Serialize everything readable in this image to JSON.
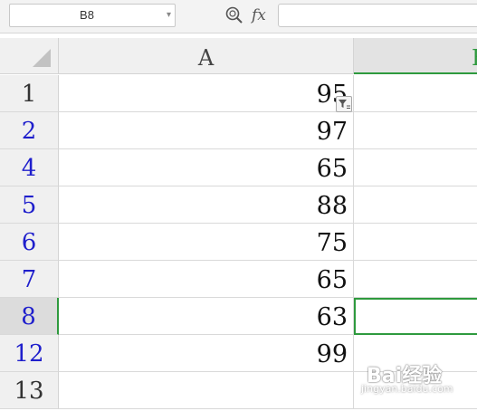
{
  "formula_bar": {
    "name_box_value": "B8",
    "fx_label": "fx",
    "zoom_icon": "zoom-formula-icon",
    "dropdown_icon": "chevron-down-icon",
    "formula_value": ""
  },
  "columns": {
    "a": "A",
    "b": "B"
  },
  "rows": [
    {
      "num": "1",
      "value": "95"
    },
    {
      "num": "2",
      "value": "97"
    },
    {
      "num": "4",
      "value": "65"
    },
    {
      "num": "5",
      "value": "88"
    },
    {
      "num": "6",
      "value": "75"
    },
    {
      "num": "7",
      "value": "65"
    },
    {
      "num": "8",
      "value": "63"
    },
    {
      "num": "12",
      "value": "99"
    },
    {
      "num": "13",
      "value": ""
    }
  ],
  "filter_icon": "filter-icon",
  "watermark": {
    "logo": "Bai经验",
    "url": "jingyan.baidu.com"
  },
  "colors": {
    "selection": "#2e9a3e",
    "filtered_row_num": "#1f1fcc",
    "header_bg": "#f0f0f0"
  }
}
